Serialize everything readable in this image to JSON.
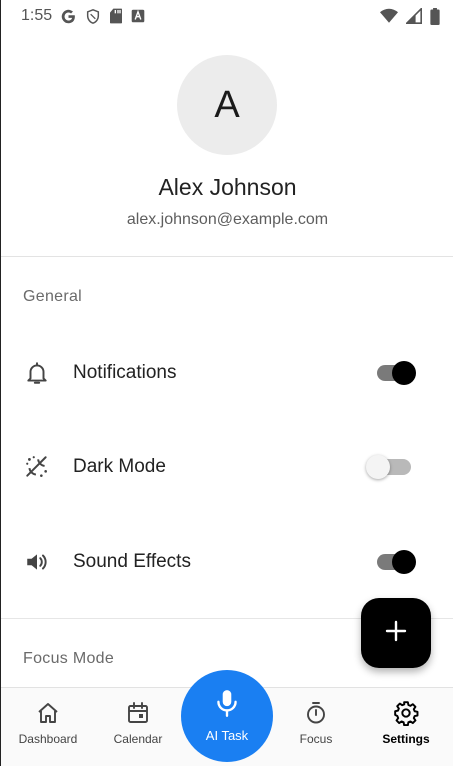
{
  "status_bar": {
    "time": "1:55",
    "icons": [
      "google-icon",
      "shield-icon",
      "sd-card-icon",
      "a-box-icon",
      "wifi-icon",
      "signal-icon",
      "battery-icon"
    ]
  },
  "profile": {
    "avatar_letter": "A",
    "name": "Alex Johnson",
    "email": "alex.johnson@example.com"
  },
  "sections": {
    "general": "General",
    "focus_mode": "Focus Mode"
  },
  "settings": {
    "notifications": {
      "label": "Notifications",
      "icon": "bell-icon",
      "enabled": true
    },
    "dark_mode": {
      "label": "Dark Mode",
      "icon": "theme-icon",
      "enabled": false
    },
    "sound_effects": {
      "label": "Sound Effects",
      "icon": "speaker-icon",
      "enabled": true
    }
  },
  "fab": {
    "icon": "plus-icon"
  },
  "nav": {
    "dashboard": "Dashboard",
    "calendar": "Calendar",
    "ai_task": "AI Task",
    "focus": "Focus",
    "settings": "Settings",
    "active": "settings"
  },
  "colors": {
    "accent": "#1a7ff2",
    "toggle_on_thumb": "#000000",
    "fab_background": "#000000"
  }
}
